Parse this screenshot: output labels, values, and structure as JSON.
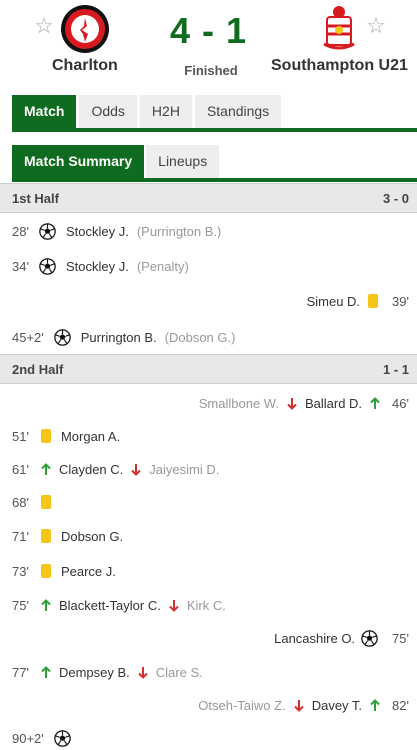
{
  "header": {
    "home_team": "Charlton",
    "away_team": "Southampton U21",
    "score": "4 - 1",
    "status": "Finished",
    "home_crest_text": "CHARLTON ATHLETIC"
  },
  "tabs": [
    {
      "label": "Match",
      "active": true
    },
    {
      "label": "Odds",
      "active": false
    },
    {
      "label": "H2H",
      "active": false
    },
    {
      "label": "Standings",
      "active": false
    }
  ],
  "subtabs": [
    {
      "label": "Match Summary",
      "active": true
    },
    {
      "label": "Lineups",
      "active": false
    }
  ],
  "halves": [
    {
      "name": "1st Half",
      "score": "3 - 0"
    },
    {
      "name": "2nd Half",
      "score": "1 - 1"
    }
  ],
  "events": [
    {
      "minute": "28'",
      "side": "home",
      "type": "goal",
      "player": "Stockley J.",
      "detail": "(Purrington B.)"
    },
    {
      "minute": "34'",
      "side": "home",
      "type": "goal",
      "player": "Stockley J.",
      "detail": "(Penalty)"
    },
    {
      "minute": "39'",
      "side": "away",
      "type": "yellow",
      "player": "Simeu D."
    },
    {
      "minute": "45+2'",
      "side": "home",
      "type": "goal",
      "player": "Purrington B.",
      "detail": "(Dobson G.)"
    },
    {
      "minute": "46'",
      "side": "away",
      "type": "sub",
      "player_in": "Ballard D.",
      "player_out": "Smallbone W."
    },
    {
      "minute": "51'",
      "side": "home",
      "type": "yellow",
      "player": "Morgan A."
    },
    {
      "minute": "61'",
      "side": "home",
      "type": "sub",
      "player_in": "Clayden C.",
      "player_out": "Jaiyesimi D."
    },
    {
      "minute": "68'",
      "side": "home",
      "type": "yellow",
      "player": ""
    },
    {
      "minute": "71'",
      "side": "home",
      "type": "yellow",
      "player": "Dobson G."
    },
    {
      "minute": "73'",
      "side": "home",
      "type": "yellow",
      "player": "Pearce J."
    },
    {
      "minute": "75'",
      "side": "home",
      "type": "sub",
      "player_in": "Blackett-Taylor C.",
      "player_out": "Kirk C."
    },
    {
      "minute": "75'",
      "side": "away",
      "type": "goal",
      "player": "Lancashire O."
    },
    {
      "minute": "77'",
      "side": "home",
      "type": "sub",
      "player_in": "Dempsey B.",
      "player_out": "Clare S."
    },
    {
      "minute": "82'",
      "side": "away",
      "type": "sub",
      "player_in": "Davey T.",
      "player_out": "Otseh-Taiwo Z."
    },
    {
      "minute": "90+2'",
      "side": "home",
      "type": "goal",
      "player": ""
    }
  ],
  "colors": {
    "accent": "#0f6b1f",
    "yellow_card": "#f5c518",
    "sub_in": "#2e9e3a",
    "sub_out": "#d32f2f"
  },
  "icons": {
    "favorite": "star-outline-icon",
    "goal": "soccer-ball-icon",
    "yellow": "yellow-card-icon",
    "sub_in": "arrow-up-icon",
    "sub_out": "arrow-down-icon"
  }
}
